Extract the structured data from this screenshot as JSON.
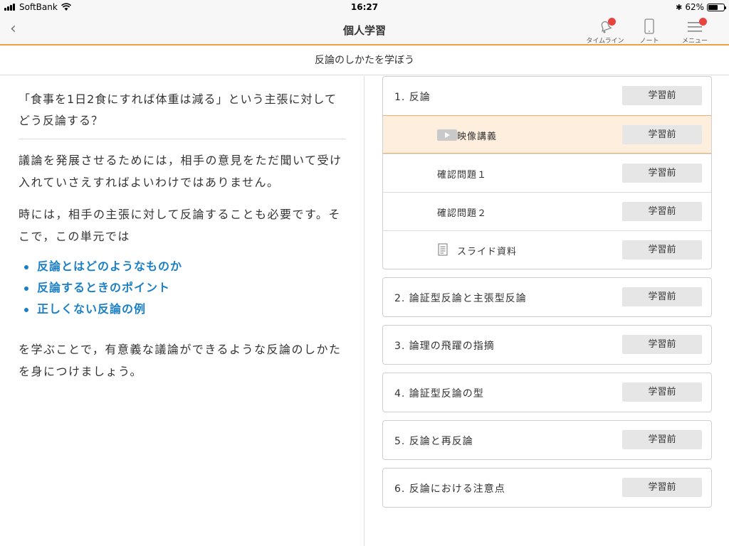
{
  "status_bar": {
    "carrier": "SoftBank",
    "time": "16:27",
    "battery_percent": "62%",
    "battery_level": 0.62
  },
  "nav": {
    "back_label": "‹",
    "title": "個人学習",
    "timeline_label": "タイムライン",
    "note_label": "ノート",
    "menu_label": "メニュー"
  },
  "sub_header": {
    "title": "反論のしかたを学ぼう"
  },
  "content": {
    "question": "「食事を1日2食にすれば体重は減る」という主張に対してどう反論する？",
    "paragraph1": "議論を発展させるためには，相手の意見をただ聞いて受け入れていさえすればよいわけではありません。",
    "paragraph2": "時には，相手の主張に対して反論することも必要です。そこで，この単元では",
    "points": [
      "反論とはどのようなものか",
      "反論するときのポイント",
      "正しくない反論の例"
    ],
    "paragraph3": "を学ぶことで，有意義な議論ができるような反論のしかたを身につけましょう。"
  },
  "lessons": [
    {
      "title": "1. 反論",
      "status": "学習前",
      "items": [
        {
          "title": "映像講義",
          "status": "学習前",
          "icon": "video-play-icon"
        },
        {
          "title": "確認問題１",
          "status": "学習前",
          "icon": ""
        },
        {
          "title": "確認問題２",
          "status": "学習前",
          "icon": ""
        },
        {
          "title": "スライド資料",
          "status": "学習前",
          "icon": "document-icon"
        }
      ]
    },
    {
      "title": "2. 論証型反論と主張型反論",
      "status": "学習前"
    },
    {
      "title": "3. 論理の飛躍の指摘",
      "status": "学習前"
    },
    {
      "title": "4. 論証型反論の型",
      "status": "学習前"
    },
    {
      "title": "5. 反論と再反論",
      "status": "学習前"
    },
    {
      "title": "6. 反論における注意点",
      "status": "学習前"
    }
  ],
  "colors": {
    "accent": "#f0a040",
    "link": "#1a7fc4",
    "badge": "#e5443f",
    "active_row": "#fdeede"
  }
}
